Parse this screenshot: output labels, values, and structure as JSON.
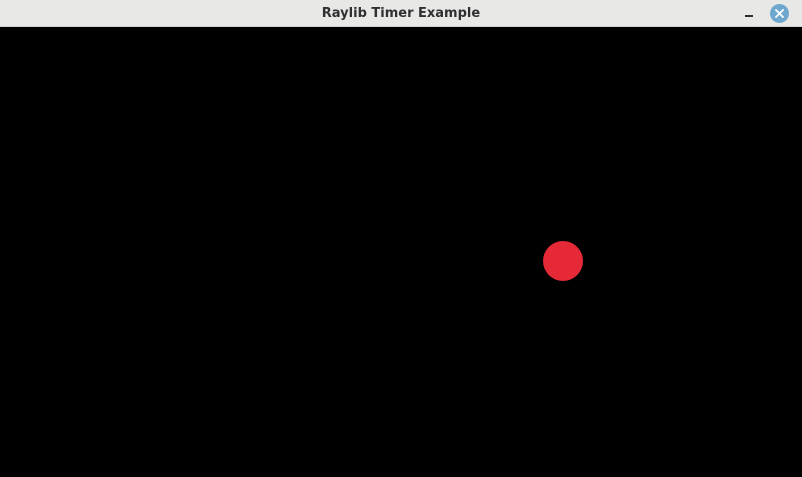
{
  "window": {
    "title": "Raylib Timer Example"
  },
  "controls": {
    "minimize_icon": "minimize-icon",
    "close_icon": "close-icon"
  },
  "canvas": {
    "background_color": "#000000",
    "ball_color": "#e62937"
  }
}
